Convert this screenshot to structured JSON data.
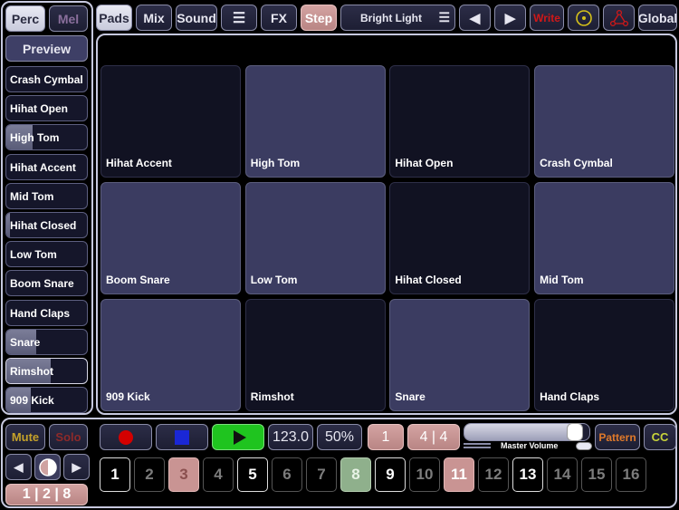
{
  "left": {
    "perc_label": "Perc",
    "mel_label": "Mel",
    "preview_label": "Preview",
    "instruments": [
      {
        "label": "Crash Cymbal",
        "level": 0
      },
      {
        "label": "Hihat Open",
        "level": 0
      },
      {
        "label": "High Tom",
        "level": 0.33
      },
      {
        "label": "Hihat Accent",
        "level": 0
      },
      {
        "label": "Mid Tom",
        "level": 0
      },
      {
        "label": "Hihat Closed",
        "level": 0.05
      },
      {
        "label": "Low Tom",
        "level": 0
      },
      {
        "label": "Boom Snare",
        "level": 0
      },
      {
        "label": "Hand Claps",
        "level": 0
      },
      {
        "label": "Snare",
        "level": 0.37
      },
      {
        "label": "Rimshot",
        "level": 0.55
      },
      {
        "label": "909 Kick",
        "level": 0.3
      }
    ]
  },
  "toolbar": {
    "pads": "Pads",
    "mix": "Mix",
    "sound": "Sound",
    "menu_icon": "hamburger-icon",
    "fx": "FX",
    "step": "Step",
    "preset": "Bright Light",
    "prev_icon": "triangle-left-icon",
    "next_icon": "triangle-right-icon",
    "write": "Write",
    "target_icon": "circle-dot-icon",
    "net_icon": "triangle-nodes-icon",
    "global": "Global"
  },
  "pads": [
    {
      "label": "Hihat Accent",
      "lit": false
    },
    {
      "label": "High Tom",
      "lit": true
    },
    {
      "label": "Hihat Open",
      "lit": false
    },
    {
      "label": "Crash Cymbal",
      "lit": true
    },
    {
      "label": "Boom Snare",
      "lit": true
    },
    {
      "label": "Low Tom",
      "lit": true
    },
    {
      "label": "Hihat Closed",
      "lit": false
    },
    {
      "label": "Mid Tom",
      "lit": true
    },
    {
      "label": "909 Kick",
      "lit": true
    },
    {
      "label": "Rimshot",
      "lit": false
    },
    {
      "label": "Snare",
      "lit": true
    },
    {
      "label": "Hand Claps",
      "lit": false
    }
  ],
  "transport": {
    "mute": "Mute",
    "solo": "Solo",
    "bank": "1 | 2 | 8",
    "tempo": "123.0",
    "swing": "50%",
    "bar": "1",
    "signature": "4 | 4",
    "master_label": "Master Volume",
    "master_level": 0.93,
    "pattern": "Pattern",
    "cc": "CC",
    "record_color": "#d40000",
    "stop_color": "#1a27d6",
    "play_bg": "#1fc41f",
    "steps": [
      {
        "n": "1",
        "state": "white"
      },
      {
        "n": "2",
        "state": "gray"
      },
      {
        "n": "3",
        "state": "salmon"
      },
      {
        "n": "4",
        "state": "gray"
      },
      {
        "n": "5",
        "state": "white"
      },
      {
        "n": "6",
        "state": "gray"
      },
      {
        "n": "7",
        "state": "gray"
      },
      {
        "n": "8",
        "state": "green"
      },
      {
        "n": "9",
        "state": "white"
      },
      {
        "n": "10",
        "state": "gray"
      },
      {
        "n": "11",
        "state": "salmon"
      },
      {
        "n": "12",
        "state": "gray"
      },
      {
        "n": "13",
        "state": "white"
      },
      {
        "n": "14",
        "state": "gray"
      },
      {
        "n": "15",
        "state": "gray"
      },
      {
        "n": "16",
        "state": "gray"
      }
    ]
  }
}
